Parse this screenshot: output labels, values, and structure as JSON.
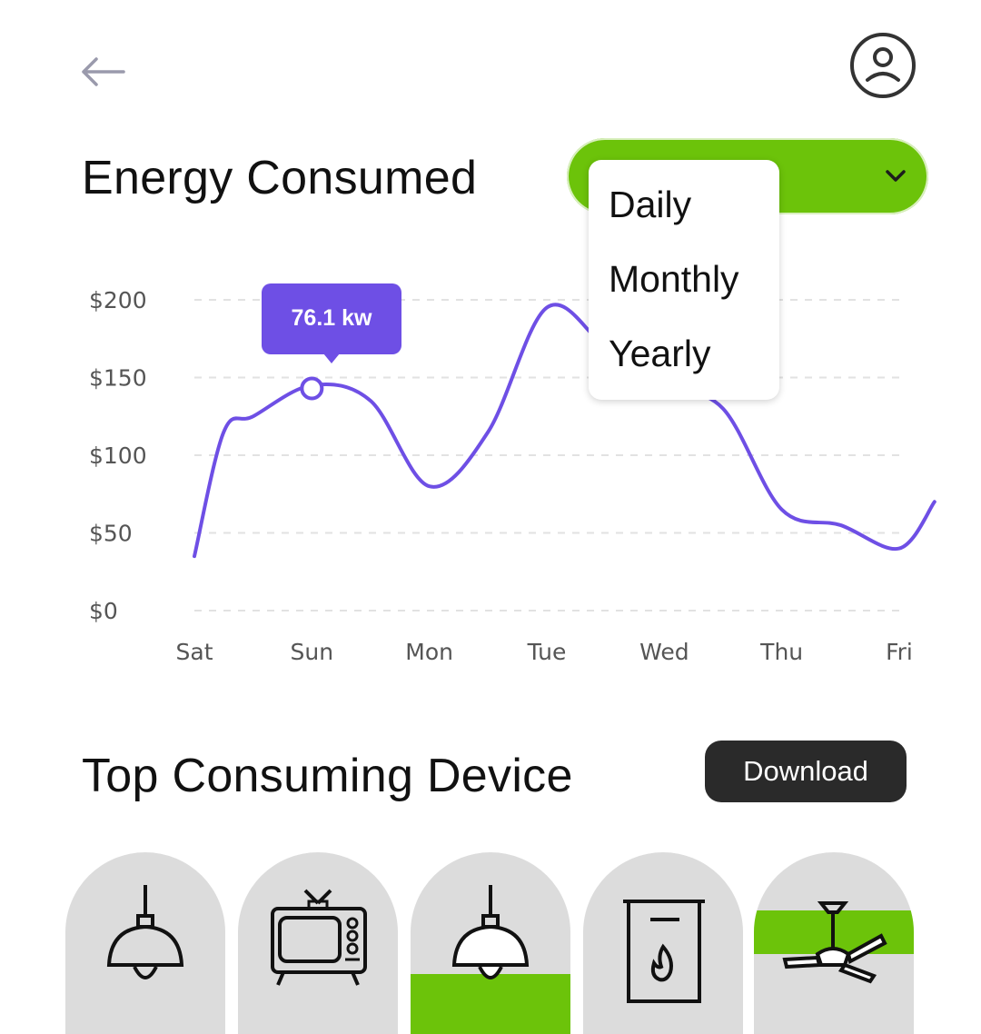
{
  "header": {
    "back_icon": "arrow-left-icon",
    "profile_icon": "user-circle-icon"
  },
  "energy": {
    "title": "Energy Consumed",
    "period_select": {
      "accent": "#6cc30a",
      "chevron_icon": "chevron-down-icon",
      "options": [
        "Daily",
        "Monthly",
        "Yearly"
      ]
    },
    "tooltip": "76.1 kw"
  },
  "chart_data": {
    "type": "line",
    "title": "",
    "xlabel": "",
    "ylabel": "",
    "categories": [
      "Sat",
      "Sun",
      "Mon",
      "Tue",
      "Wed",
      "Thu",
      "Fri"
    ],
    "x": [
      0,
      0.25,
      0.5,
      1,
      1.5,
      2,
      2.5,
      3,
      3.5,
      4,
      4.5,
      5,
      5.5,
      6,
      6.3
    ],
    "y": [
      35,
      115,
      125,
      145,
      135,
      80,
      115,
      195,
      170,
      145,
      130,
      65,
      55,
      40,
      70
    ],
    "highlight": {
      "x": 1,
      "y": 143
    },
    "y_ticks": [
      "$0",
      "$50",
      "$100",
      "$150",
      "$200"
    ],
    "ylim": [
      0,
      200
    ],
    "grid": true,
    "line_color": "#6e4fe5"
  },
  "devices": {
    "title": "Top Consuming Device",
    "download_label": "Download",
    "items": [
      {
        "icon": "pendant-lamp-icon",
        "highlight": "none"
      },
      {
        "icon": "tv-icon",
        "highlight": "none"
      },
      {
        "icon": "pendant-lamp-icon",
        "highlight": "bottom"
      },
      {
        "icon": "water-heater-icon",
        "highlight": "none"
      },
      {
        "icon": "ceiling-fan-icon",
        "highlight": "middle"
      }
    ]
  }
}
